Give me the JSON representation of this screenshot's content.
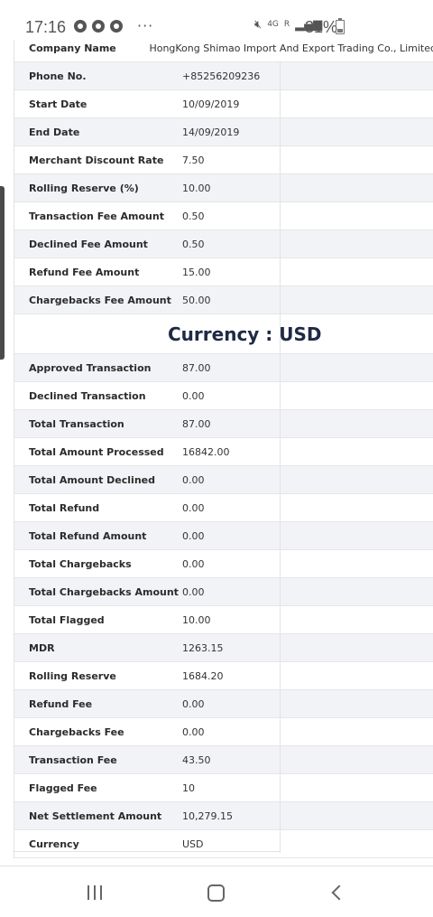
{
  "status_bar": {
    "time": "17:16",
    "more": "···",
    "network": "4G",
    "roaming": "R",
    "battery": "31%"
  },
  "details": [
    {
      "label": "Company Name",
      "value": "HongKong Shimao Import And Export Trading Co., Limited"
    },
    {
      "label": "Phone No.",
      "value": "+85256209236"
    },
    {
      "label": "Start Date",
      "value": "10/09/2019"
    },
    {
      "label": "End Date",
      "value": "14/09/2019"
    },
    {
      "label": "Merchant Discount Rate",
      "value": "7.50"
    },
    {
      "label": "Rolling Reserve (%)",
      "value": "10.00"
    },
    {
      "label": "Transaction Fee Amount",
      "value": "0.50"
    },
    {
      "label": "Declined Fee Amount",
      "value": "0.50"
    },
    {
      "label": "Refund Fee Amount",
      "value": "15.00"
    },
    {
      "label": "Chargebacks Fee Amount",
      "value": "50.00"
    }
  ],
  "currency_heading": "Currency : USD",
  "summary": [
    {
      "label": "Approved Transaction",
      "value": "87.00"
    },
    {
      "label": "Declined Transaction",
      "value": "0.00"
    },
    {
      "label": "Total Transaction",
      "value": "87.00"
    },
    {
      "label": "Total Amount Processed",
      "value": "16842.00"
    },
    {
      "label": "Total Amount Declined",
      "value": "0.00"
    },
    {
      "label": "Total Refund",
      "value": "0.00"
    },
    {
      "label": "Total Refund Amount",
      "value": "0.00"
    },
    {
      "label": "Total Chargebacks",
      "value": "0.00"
    },
    {
      "label": "Total Chargebacks Amount",
      "value": "0.00"
    },
    {
      "label": "Total Flagged",
      "value": "10.00"
    },
    {
      "label": "MDR",
      "value": "1263.15"
    },
    {
      "label": "Rolling Reserve",
      "value": "1684.20"
    },
    {
      "label": "Refund Fee",
      "value": "0.00"
    },
    {
      "label": "Chargebacks Fee",
      "value": "0.00"
    },
    {
      "label": "Transaction Fee",
      "value": "43.50"
    },
    {
      "label": "Flagged Fee",
      "value": "10"
    },
    {
      "label": "Net Settlement Amount",
      "value": "10,279.15"
    },
    {
      "label": "Currency",
      "value": "USD"
    }
  ]
}
